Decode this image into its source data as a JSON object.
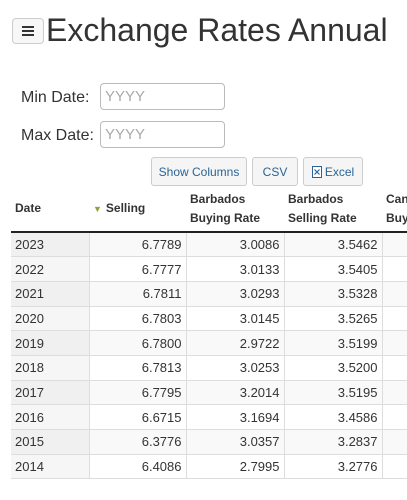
{
  "header": {
    "title": "Exchange Rates Annual",
    "menu_icon": "hamburger-menu-icon"
  },
  "filters": {
    "min_label": "Min Date:",
    "min_placeholder": "YYYY",
    "min_value": "",
    "max_label": "Max Date:",
    "max_placeholder": "YYYY",
    "max_value": ""
  },
  "toolbar": {
    "show_columns": "Show Columns",
    "csv": "CSV",
    "excel": "Excel",
    "excel_icon": "excel-file-icon"
  },
  "table": {
    "headers": {
      "date": "Date",
      "selling": "Selling",
      "barbados_buying_1": "Barbados",
      "barbados_buying_2": "Buying Rate",
      "barbados_selling_1": "Barbados",
      "barbados_selling_2": "Selling Rate",
      "canada_1": "Can",
      "canada_2": "Buyi"
    },
    "sorted_column": "Selling",
    "rows": [
      [
        "2023",
        "6.7789",
        "3.0086",
        "3.5462",
        ""
      ],
      [
        "2022",
        "6.7777",
        "3.0133",
        "3.5405",
        ""
      ],
      [
        "2021",
        "6.7811",
        "3.0293",
        "3.5328",
        ""
      ],
      [
        "2020",
        "6.7803",
        "3.0145",
        "3.5265",
        ""
      ],
      [
        "2019",
        "6.7800",
        "2.9722",
        "3.5199",
        ""
      ],
      [
        "2018",
        "6.7813",
        "3.0253",
        "3.5200",
        ""
      ],
      [
        "2017",
        "6.7795",
        "3.2014",
        "3.5195",
        ""
      ],
      [
        "2016",
        "6.6715",
        "3.1694",
        "3.4586",
        ""
      ],
      [
        "2015",
        "6.3776",
        "3.0357",
        "3.2837",
        ""
      ],
      [
        "2014",
        "6.4086",
        "2.7995",
        "3.2776",
        ""
      ]
    ]
  }
}
